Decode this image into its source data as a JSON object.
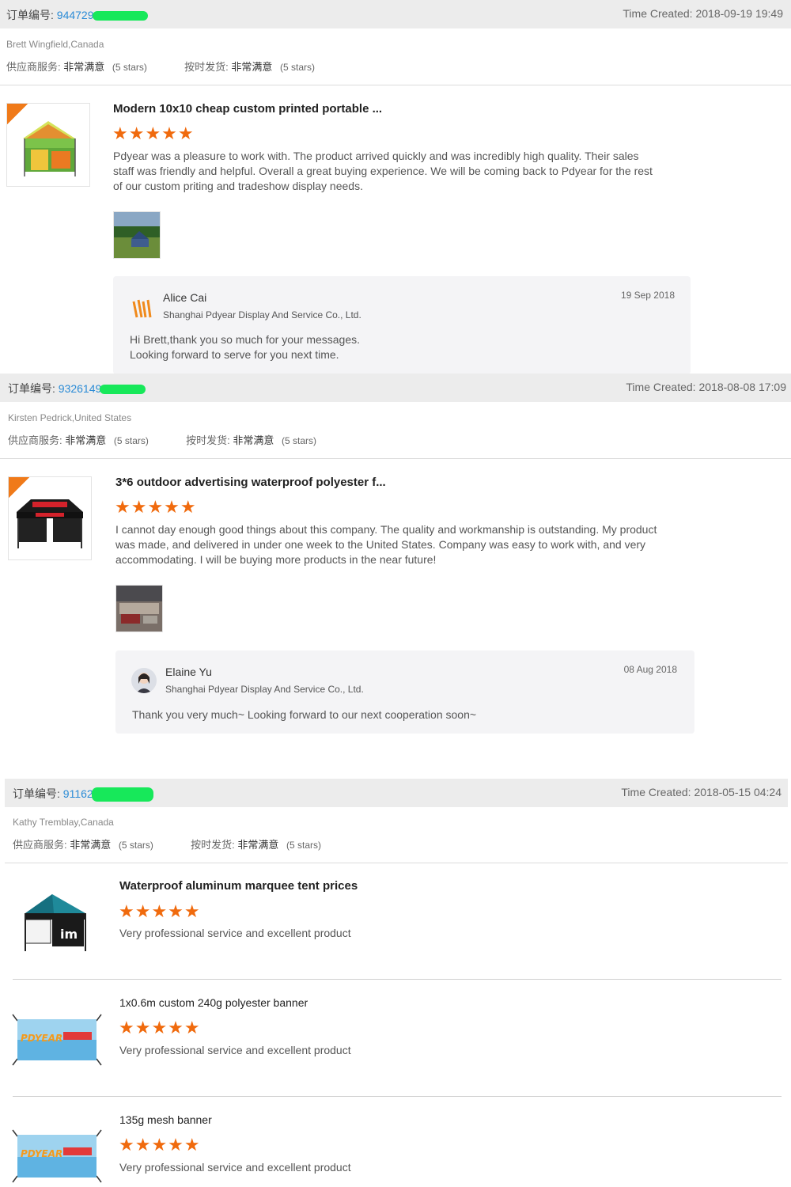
{
  "orders": [
    {
      "order_label": "订单编号:",
      "order_number": "944729",
      "time_created": "Time Created: 2018-09-19 19:49",
      "buyer": "Brett Wingfield,Canada",
      "ratings": [
        {
          "label": "供应商服务:",
          "value": "非常满意",
          "stars_text": "(5 stars)"
        },
        {
          "label": "按时发货:",
          "value": "非常满意",
          "stars_text": "(5 stars)"
        }
      ],
      "items": [
        {
          "title": "Modern 10x10 cheap custom printed portable ...",
          "stars": "★★★★★",
          "rating": 5,
          "comment": "Pdyear was a pleasure to work with. The product arrived quickly and was incredibly high quality. Their sales staff was friendly and helpful. Overall a great buying experience. We will be coming back to Pdyear for the rest of our custom priting and tradeshow display needs."
        }
      ],
      "reply": {
        "name": "Alice Cai",
        "company": "Shanghai Pdyear Display And Service Co., Ltd.",
        "date": "19 Sep 2018",
        "line1": "Hi Brett,thank you so much for your messages.",
        "line2": "Looking forward to serve for you next time."
      }
    },
    {
      "order_label": "订单编号:",
      "order_number": "9326149",
      "time_created": "Time Created: 2018-08-08 17:09",
      "buyer": "Kirsten Pedrick,United States",
      "ratings": [
        {
          "label": "供应商服务:",
          "value": "非常满意",
          "stars_text": "(5 stars)"
        },
        {
          "label": "按时发货:",
          "value": "非常满意",
          "stars_text": "(5 stars)"
        }
      ],
      "items": [
        {
          "title": "3*6 outdoor advertising waterproof polyester f...",
          "stars": "★★★★★",
          "rating": 5,
          "comment": "I cannot day enough good things about this company. The quality and workmanship is outstanding. My product was made, and delivered in under one week to the United States. Company was  easy to work with, and  very accommodating. I will be buying more products in the near future!"
        }
      ],
      "reply": {
        "name": "Elaine Yu",
        "company": "Shanghai Pdyear Display And Service Co., Ltd.",
        "date": "08 Aug 2018",
        "line1": "Thank you very much~ Looking forward to our next cooperation soon~"
      }
    },
    {
      "order_label": "订单编号:",
      "order_number": "91162",
      "time_created": "Time Created: 2018-05-15 04:24",
      "buyer": "Kathy Tremblay,Canada",
      "ratings": [
        {
          "label": "供应商服务:",
          "value": "非常满意",
          "stars_text": "(5 stars)"
        },
        {
          "label": "按时发货:",
          "value": "非常满意",
          "stars_text": "(5 stars)"
        }
      ],
      "items": [
        {
          "title": "Waterproof aluminum marquee tent prices",
          "stars": "★★★★★",
          "rating": 5,
          "comment": "Very professional service and excellent product"
        },
        {
          "title": "1x0.6m custom 240g polyester banner",
          "stars": "★★★★★",
          "rating": 5,
          "comment": "Very professional service and excellent product"
        },
        {
          "title": "135g mesh banner",
          "stars": "★★★★★",
          "rating": 5,
          "comment": "Very professional service and excellent product"
        }
      ]
    }
  ],
  "images": {
    "sale_tag": "SALE",
    "banner_text": "PDYEAR"
  },
  "colors": {
    "star": "#f06a0d",
    "order_number": "#2a8bd6",
    "bar_bg": "#ececec",
    "reply_bg": "#f4f4f6",
    "redaction": "#17e85a"
  }
}
